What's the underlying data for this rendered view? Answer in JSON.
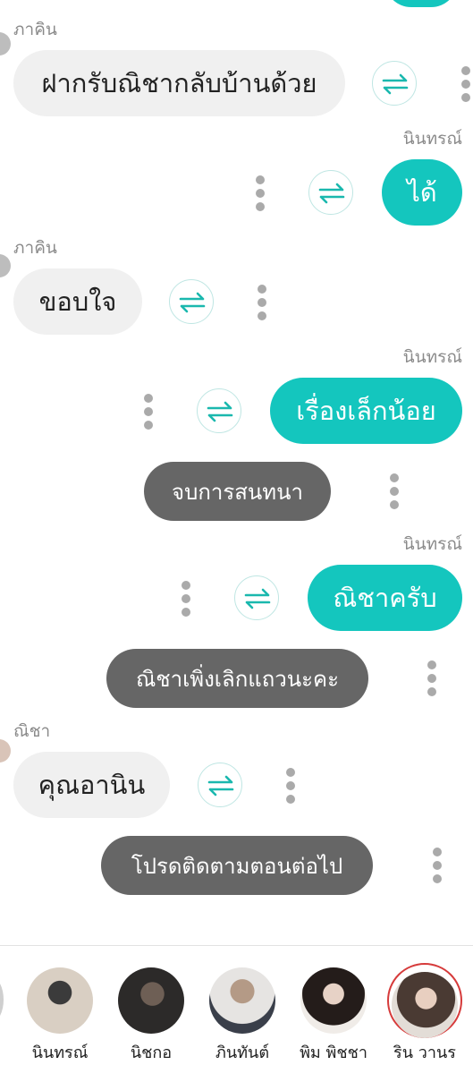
{
  "colors": {
    "accent": "#14c6be",
    "incoming_bubble": "#f0f0f0",
    "system_bubble": "#666666"
  },
  "messages": [
    {
      "sender": "ภาคิน",
      "text": "ฝากรับณิชากลับบ้านด้วย",
      "side": "left"
    },
    {
      "sender": "นินทรณ์",
      "text": "ได้",
      "side": "right"
    },
    {
      "sender": "ภาคิน",
      "text": "ขอบใจ",
      "side": "left"
    },
    {
      "sender": "นินทรณ์",
      "text": "เรื่องเล็กน้อย",
      "side": "right"
    },
    {
      "text": "จบการสนทนา",
      "side": "system"
    },
    {
      "sender": "นินทรณ์",
      "text": "ณิชาครับ",
      "side": "right"
    },
    {
      "text": "ณิชาเพิ่งเลิกแถวนะคะ",
      "side": "system"
    },
    {
      "sender": "ณิชา",
      "text": "คุณอานิน",
      "side": "left"
    },
    {
      "text": "โปรดติดตามตอนต่อไป",
      "side": "system"
    }
  ],
  "icons": {
    "translate": "swap-arrows-icon",
    "more": "vertical-dots-icon"
  },
  "characters": [
    {
      "name": "นินทรณ์"
    },
    {
      "name": "นิชกอ"
    },
    {
      "name": "ภินทันต์"
    },
    {
      "name": "พิม พิชชา"
    },
    {
      "name": "ริน วานร",
      "selected": true
    }
  ]
}
